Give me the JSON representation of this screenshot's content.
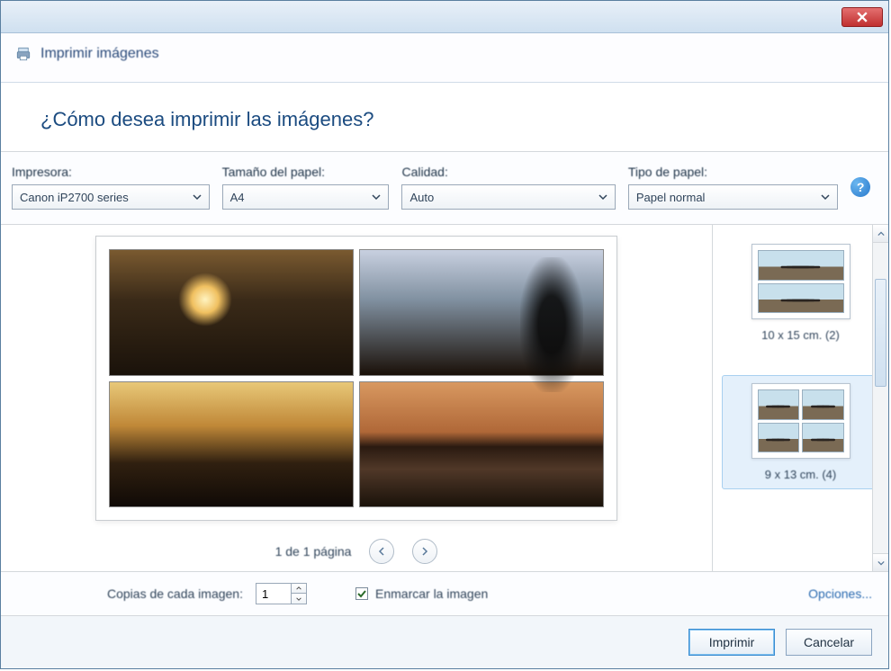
{
  "window": {
    "title": "Imprimir imágenes"
  },
  "heading": "¿Cómo desea imprimir las imágenes?",
  "fields": {
    "printer": {
      "label": "Impresora:",
      "value": "Canon iP2700 series"
    },
    "paper_size": {
      "label": "Tamaño del papel:",
      "value": "A4"
    },
    "quality": {
      "label": "Calidad:",
      "value": "Auto"
    },
    "paper_type": {
      "label": "Tipo de papel:",
      "value": "Papel normal"
    }
  },
  "pager": {
    "label": "1 de 1 página"
  },
  "layouts": {
    "top_caption": "",
    "items": [
      {
        "id": "10x15-2",
        "caption": "10 x 15 cm. (2)",
        "grid": 2,
        "selected": false
      },
      {
        "id": "9x13-4",
        "caption": "9 x 13 cm. (4)",
        "grid": 4,
        "selected": true
      }
    ]
  },
  "footer": {
    "copies_label": "Copias de cada imagen:",
    "copies_value": "1",
    "fit_checked": true,
    "fit_label": "Enmarcar la imagen",
    "options_link": "Opciones..."
  },
  "buttons": {
    "print": "Imprimir",
    "cancel": "Cancelar"
  }
}
